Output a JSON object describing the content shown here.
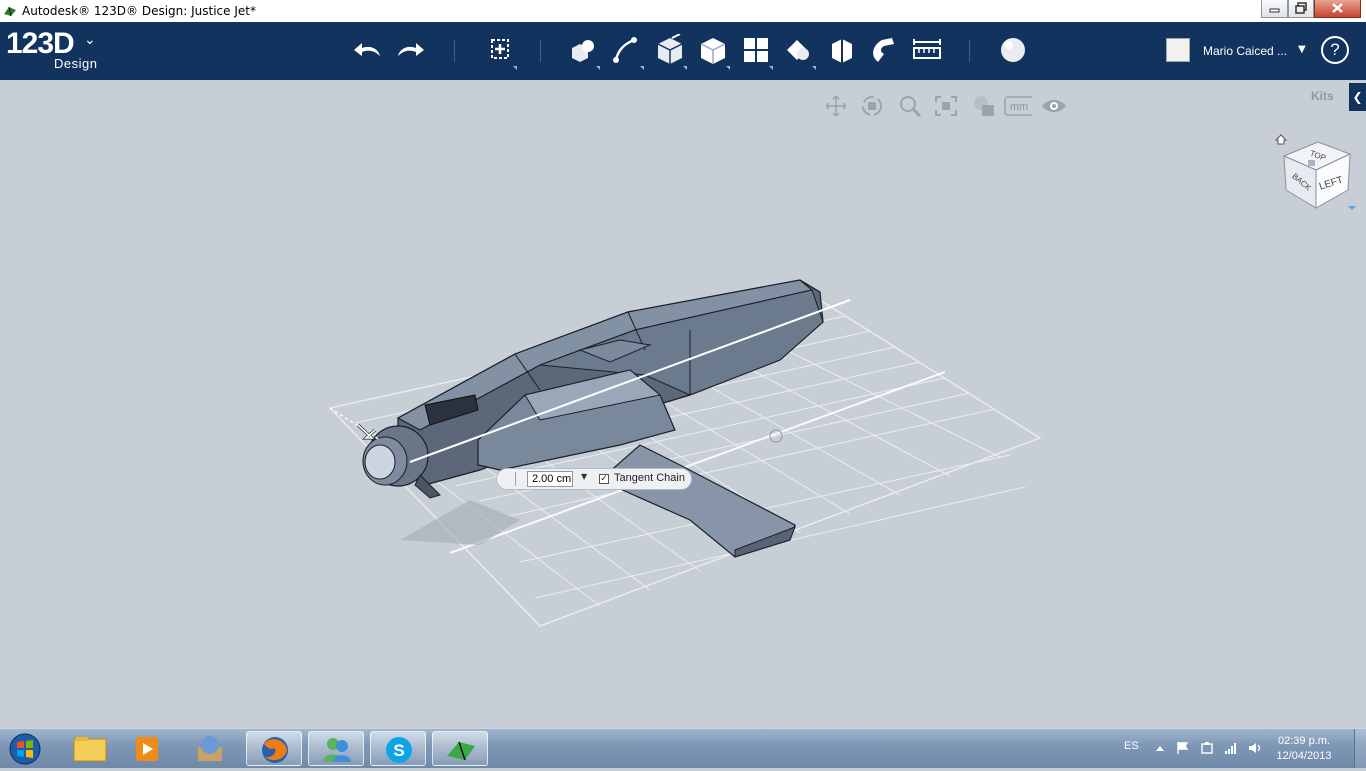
{
  "window": {
    "title": "Autodesk® 123D® Design: Justice Jet*"
  },
  "toolbar": {
    "logo": "123D",
    "logo_sub": "Design",
    "icons": [
      "undo-icon",
      "redo-icon",
      "transform-icon",
      "primitives-icon",
      "sketch-icon",
      "construct-icon",
      "modify-icon",
      "pattern-icon",
      "grouping-icon",
      "combine-icon",
      "snap-icon",
      "measure-icon",
      "material-icon"
    ],
    "user_name": "Mario Caiced ...",
    "help_label": "?"
  },
  "nav_bar": {
    "icons": [
      "pan-icon",
      "orbit-icon",
      "zoom-icon",
      "fit-icon",
      "view-mode-icon",
      "units-icon",
      "visibility-icon"
    ],
    "units_label": "mm"
  },
  "kits": {
    "label": "Kits"
  },
  "view_cube": {
    "faces": [
      "TOP",
      "BACK",
      "LEFT"
    ]
  },
  "extrude_panel": {
    "value": "2.00 cm",
    "tangent_chain_label": "Tangent Chain",
    "tangent_chain_checked": true
  },
  "taskbar": {
    "apps": [
      "windows-explorer",
      "media-player",
      "app-3",
      "firefox",
      "messenger",
      "skype",
      "123d-design"
    ],
    "tray": {
      "language": "ES",
      "time": "02:39 p.m.",
      "date": "12/04/2013"
    }
  },
  "colors": {
    "toolbar_bg": "#12335e",
    "viewport_bg": "#c8ced6",
    "model": "#5e6a7a"
  }
}
